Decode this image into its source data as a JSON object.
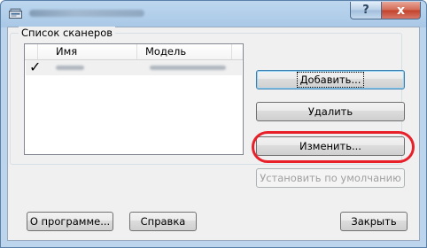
{
  "window": {
    "help_glyph": "?",
    "close_glyph": "x"
  },
  "group": {
    "label": "Список сканеров"
  },
  "list": {
    "check_column": "",
    "columns": [
      "Имя",
      "Модель"
    ],
    "rows": [
      {
        "checked": "✓",
        "name": "",
        "model": ""
      }
    ]
  },
  "buttons": {
    "add": "Добавить...",
    "delete": "Удалить",
    "edit": "Изменить...",
    "set_default": "Установить по умолчанию",
    "about": "О программе...",
    "help": "Справка",
    "close": "Закрыть"
  },
  "colors": {
    "highlight": "#e8202a",
    "title_bar": "#a9c8e6",
    "close_button": "#c2412a"
  }
}
